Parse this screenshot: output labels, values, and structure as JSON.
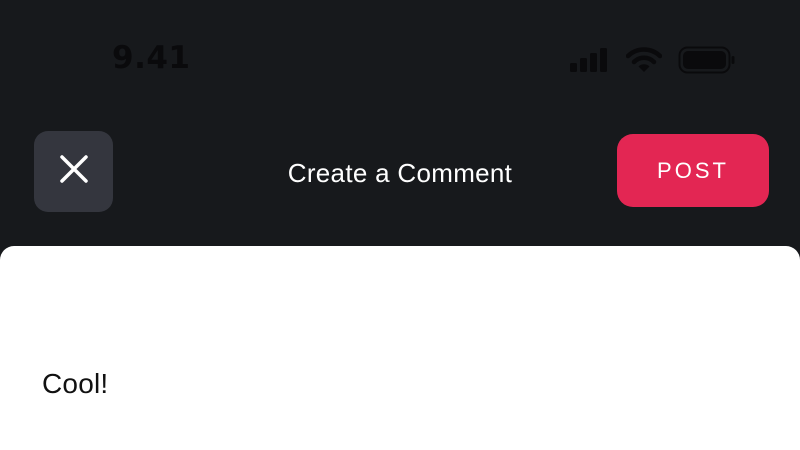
{
  "status_bar": {
    "time": "9.41",
    "icons": [
      "cellular-signal-icon",
      "wifi-icon",
      "battery-icon"
    ]
  },
  "header": {
    "close_icon": "close-icon",
    "title": "Create a Comment",
    "post_label": "POST"
  },
  "composer": {
    "text": "Cool!"
  },
  "colors": {
    "background": "#17191c",
    "close_button": "#34363e",
    "post_button": "#e32653",
    "sheet": "#ffffff"
  }
}
